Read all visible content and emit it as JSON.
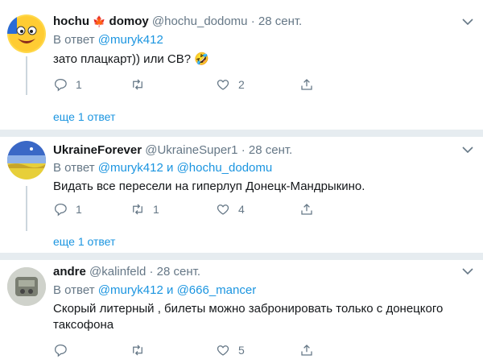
{
  "colors": {
    "link": "#1b95e0",
    "muted": "#657786",
    "separator": "#e6ecf0",
    "thread_line": "#ccd6dd"
  },
  "tweets": [
    {
      "name": "hochu",
      "flag": "🍁",
      "name2": "domoy",
      "handle": "@hochu_dodomu",
      "dot": "·",
      "time": "28 сент.",
      "reply_prefix": "В ответ",
      "reply_users": [
        "@muryk412"
      ],
      "text": "зато  плацкарт))  или  СВ? 🤣",
      "replies": "1",
      "retweets": "",
      "likes": "2",
      "more": "еще 1 ответ"
    },
    {
      "name": "UkraineForever",
      "handle": "@UkraineSuper1",
      "dot": "·",
      "time": "28 сент.",
      "reply_prefix": "В ответ",
      "reply_users": [
        "@muryk412",
        "@hochu_dodomu"
      ],
      "reply_and": "и",
      "text": "Видать все пересели на гиперлуп Донецк-Мандрыкино.",
      "replies": "1",
      "retweets": "1",
      "likes": "4",
      "more": "еще 1 ответ"
    },
    {
      "name": "andre",
      "handle": "@kalinfeld",
      "dot": "·",
      "time": "28 сент.",
      "reply_prefix": "В ответ",
      "reply_users": [
        "@muryk412",
        "@666_mancer"
      ],
      "reply_and": "и",
      "text_line1": "Скорый литерный , билеты можно  забронировать только с донецкого",
      "text_line2": "таксофона",
      "replies": "",
      "retweets": "",
      "likes": "5",
      "more": ""
    }
  ]
}
